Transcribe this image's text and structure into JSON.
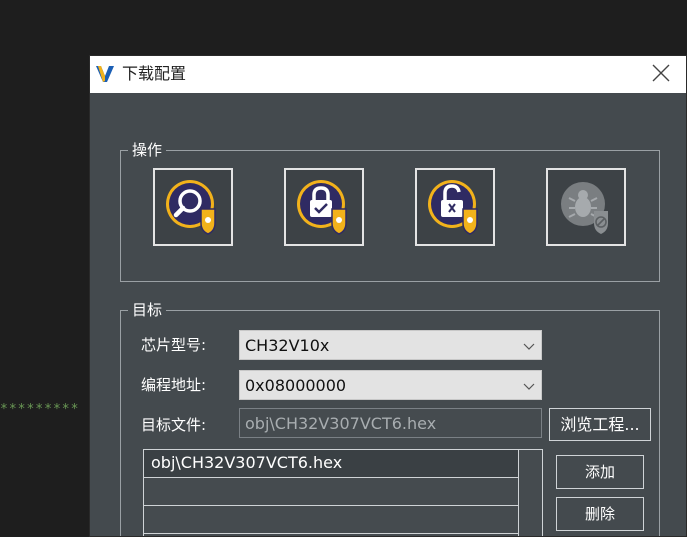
{
  "background": {
    "code_fragment": "*********"
  },
  "dialog": {
    "title": "下载配置",
    "close_icon": "close-icon"
  },
  "operations": {
    "legend": "操作",
    "buttons": [
      {
        "name": "query-button",
        "icon": "magnifier-icon",
        "enabled": true
      },
      {
        "name": "protect-button",
        "icon": "lock-check-icon",
        "enabled": true
      },
      {
        "name": "unprotect-button",
        "icon": "unlock-icon",
        "enabled": true
      },
      {
        "name": "debug-button",
        "icon": "bug-disabled-icon",
        "enabled": false
      }
    ]
  },
  "target": {
    "legend": "目标",
    "chip_label": "芯片型号:",
    "chip_value": "CH32V10x",
    "address_label": "编程地址:",
    "address_value": "0x08000000",
    "file_label": "目标文件:",
    "file_value": "obj\\CH32V307VCT6.hex",
    "browse_label": "浏览工程...",
    "files": [
      "obj\\CH32V307VCT6.hex",
      "",
      ""
    ],
    "add_label": "添加",
    "delete_label": "删除"
  },
  "colors": {
    "dialog_bg": "#444a4e",
    "accent_gold": "#f2b21b",
    "icon_purple": "#2f2b63",
    "editor_bg": "#1e1e1e"
  }
}
